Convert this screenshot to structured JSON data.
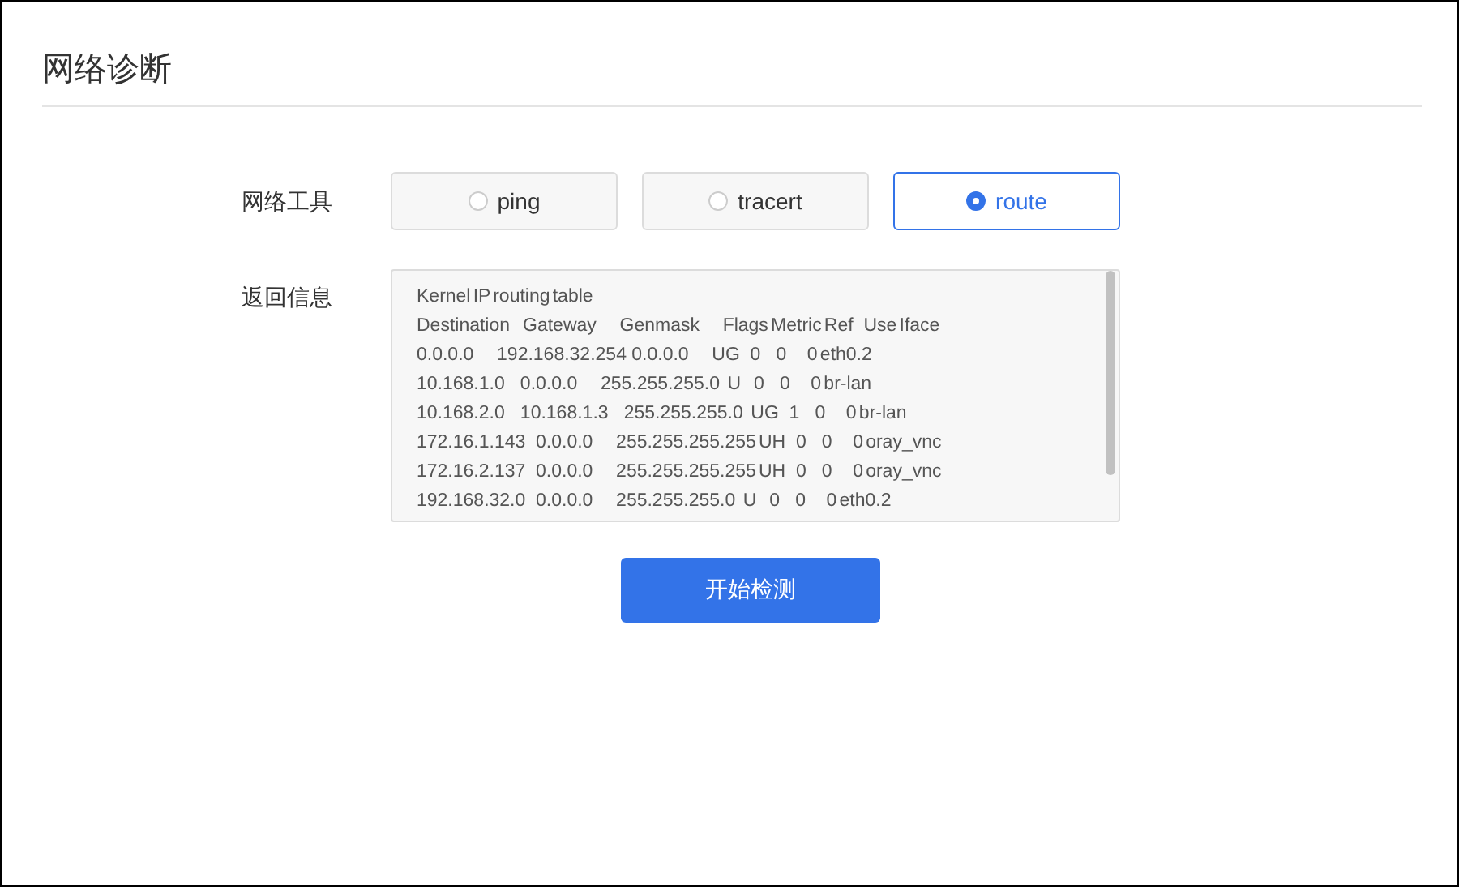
{
  "page": {
    "title": "网络诊断"
  },
  "tool": {
    "label": "网络工具",
    "options": [
      {
        "label": "ping",
        "selected": false
      },
      {
        "label": "tracert",
        "selected": false
      },
      {
        "label": "route",
        "selected": true
      }
    ]
  },
  "output": {
    "label": "返回信息",
    "lines": [
      "Kernel IP routing table",
      "Destination     Gateway         Genmask         Flags Metric Ref    Use Iface",
      "0.0.0.0         192.168.32.254  0.0.0.0         UG    0      0        0 eth0.2",
      "10.168.1.0      0.0.0.0         255.255.255.0   U     0      0        0 br-lan",
      "10.168.2.0      10.168.1.3      255.255.255.0   UG    1      0        0 br-lan",
      "172.16.1.143    0.0.0.0         255.255.255.255 UH    0      0        0 oray_vnc",
      "172.16.2.137    0.0.0.0         255.255.255.255 UH    0      0        0 oray_vnc",
      "192.168.32.0    0.0.0.0         255.255.255.0   U     0      0        0 eth0.2"
    ]
  },
  "start_button": "开始检测"
}
